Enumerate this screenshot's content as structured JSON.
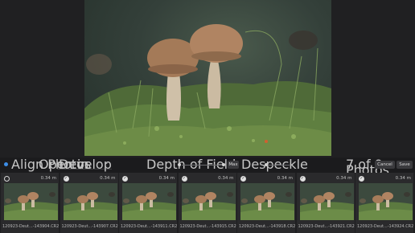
{
  "toolbar": {
    "align_label": "Align Photos",
    "open_in_label": "Open in",
    "open_in_value": "Develop",
    "depth_label": "Depth of Field",
    "max_label": "Max",
    "despeckle_label": "Despeckle",
    "count_label": "7 of 9 Photos",
    "cancel_label": "Cancel",
    "save_label": "Save",
    "accent": "#3d8ee8"
  },
  "filmstrip": {
    "frames": [
      {
        "checked": false,
        "distance": "0.34 m",
        "name": "120923-Deut...-143904.CR2"
      },
      {
        "checked": true,
        "distance": "0.34 m",
        "name": "120923-Deut...-143907.CR2"
      },
      {
        "checked": true,
        "distance": "0.34 m",
        "name": "120923-Deut...-143911.CR2"
      },
      {
        "checked": true,
        "distance": "0.34 m",
        "name": "120923-Deut...-143915.CR2"
      },
      {
        "checked": true,
        "distance": "0.34 m",
        "name": "120923-Deut...-143918.CR2"
      },
      {
        "checked": true,
        "distance": "0.34 m",
        "name": "120923-Deut...-143921.CR2"
      },
      {
        "checked": true,
        "distance": "0.34 m",
        "name": "120923-Deut...-143924.CR2"
      }
    ]
  }
}
